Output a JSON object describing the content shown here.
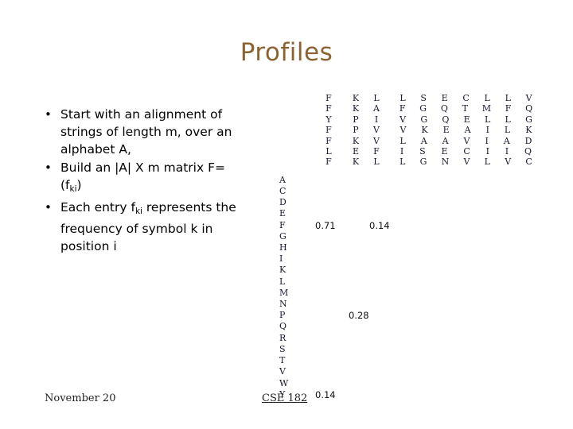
{
  "slide": {
    "title": "Profiles",
    "title_color": "#8B6332"
  },
  "body": {
    "bullet_mark": "•",
    "bullets": [
      {
        "pre": "Start with an alignment of strings of length m, over an alphabet A,",
        "sub": "",
        "post": ""
      },
      {
        "pre": "Build an |A| X m matrix F=(f",
        "sub": "ki",
        "post": ")"
      },
      {
        "pre": "Each entry f",
        "sub": "ki",
        "post": " represents the frequency of symbol k in position i"
      }
    ]
  },
  "alignment": {
    "rows": [
      [
        "F",
        "K",
        "L",
        "L",
        "S",
        "E",
        "C",
        "L",
        "L",
        "V"
      ],
      [
        "F",
        "K",
        "A",
        "F",
        "G",
        "Q",
        "T",
        "M",
        "F",
        "Q"
      ],
      [
        "Y",
        "P",
        "I",
        "V",
        "G",
        "Q",
        "E",
        "L",
        "L",
        "G"
      ],
      [
        "F",
        "P",
        "V",
        "V",
        "K",
        "E",
        "A",
        "I",
        "L",
        "K"
      ],
      [
        "F",
        "K",
        "V",
        "L",
        "A",
        "A",
        "V",
        "I",
        "A",
        "D"
      ],
      [
        "L",
        "E",
        "F",
        "I",
        "S",
        "E",
        "C",
        "I",
        "I",
        "Q"
      ],
      [
        "F",
        "K",
        "L",
        "L",
        "G",
        "N",
        "V",
        "L",
        "V",
        "C"
      ]
    ]
  },
  "matrix": {
    "grid_color": "#333399",
    "groups": [
      {
        "residues": [
          "A",
          "C",
          "D",
          "E"
        ],
        "values": [
          "",
          "",
          "",
          ""
        ]
      },
      {
        "residues": [
          "F"
        ],
        "values": [
          "0.71",
          "",
          "0.14",
          ""
        ]
      },
      {
        "residues": [
          "G",
          "H",
          "I",
          "K",
          "L",
          "M",
          "N"
        ],
        "values": [
          "",
          "",
          "",
          ""
        ]
      },
      {
        "residues": [
          "P"
        ],
        "values": [
          "",
          "0.28",
          "",
          ""
        ]
      },
      {
        "residues": [
          "Q",
          "R",
          "S",
          "T",
          "V",
          "W"
        ],
        "values": [
          "",
          "",
          "",
          ""
        ]
      },
      {
        "residues": [
          "Y"
        ],
        "values": [
          "0.14",
          "",
          "",
          ""
        ]
      }
    ]
  },
  "footer": {
    "date": "November 20",
    "course": "CSE 182"
  }
}
